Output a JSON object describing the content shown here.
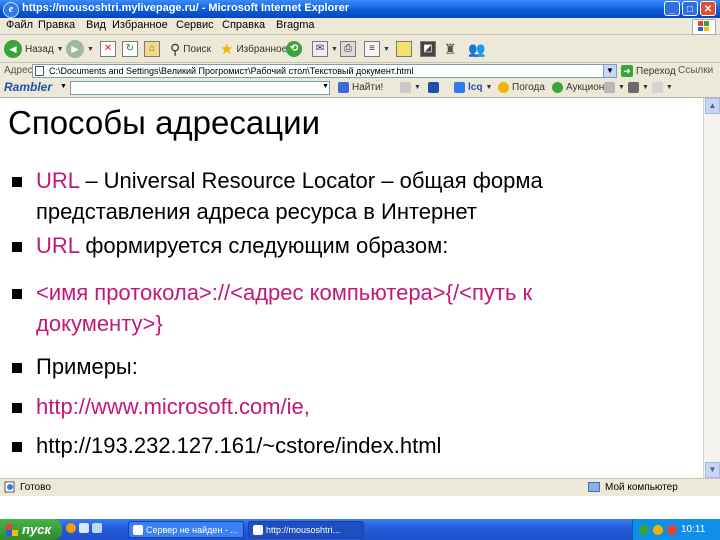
{
  "window": {
    "title": "https://mousoshtri.mylivepage.ru/ - Microsoft Internet Explorer"
  },
  "menu": {
    "items": [
      "Файл",
      "Правка",
      "Вид",
      "Избранное",
      "Сервис",
      "Справка",
      "Bragma"
    ]
  },
  "toolbar": {
    "back_label": "Назад",
    "search_label": "Поиск",
    "favorites_label": "Избранное"
  },
  "address": {
    "label": "Адрес:",
    "value": "C:\\Documents and Settings\\Великий Прогромист\\Рабочий стол\\Текстовый документ.html",
    "go_label": "Переход",
    "links_label": "Ссылки"
  },
  "rambler": {
    "logo": "Rambler",
    "find_label": "Найти!",
    "weather_label": "Погода",
    "auction_label": "Аукцион"
  },
  "slide": {
    "title": "Способы адресации",
    "bullets": [
      {
        "lines": [
          "URL – Universal Resource Locator – общая форма",
          "представления адреса ресурса в Интернет"
        ]
      },
      {
        "lines": [
          "URL формируется следующим образом:"
        ]
      },
      {
        "lines": [
          "<имя протокола>://<адрес компьютера>{/<путь к",
          "документу>}"
        ]
      },
      {
        "lines": [
          "Примеры:"
        ]
      },
      {
        "lines": [
          "http://www.microsoft.com/ie,"
        ]
      },
      {
        "lines": [
          "http://193.232.127.161/~cstore/index.html"
        ]
      }
    ],
    "bullet1_prefix": "URL",
    "bullet1_rest": " – Universal Resource Locator – общая форма",
    "bullet2_prefix": "URL",
    "bullet2_rest": " формируется следующим образом:"
  },
  "status": {
    "left_text": "Готово",
    "zone_text": "Мой компьютер"
  },
  "taskbar": {
    "start_label": "пуск",
    "tasks": [
      "Сервер не найден - ...",
      "http://mousoshtri..."
    ],
    "time": "10:11"
  },
  "colors": {
    "accent": "#c2187a",
    "title_bar": "#0a5ad8",
    "start_green": "#2e8b2e"
  }
}
